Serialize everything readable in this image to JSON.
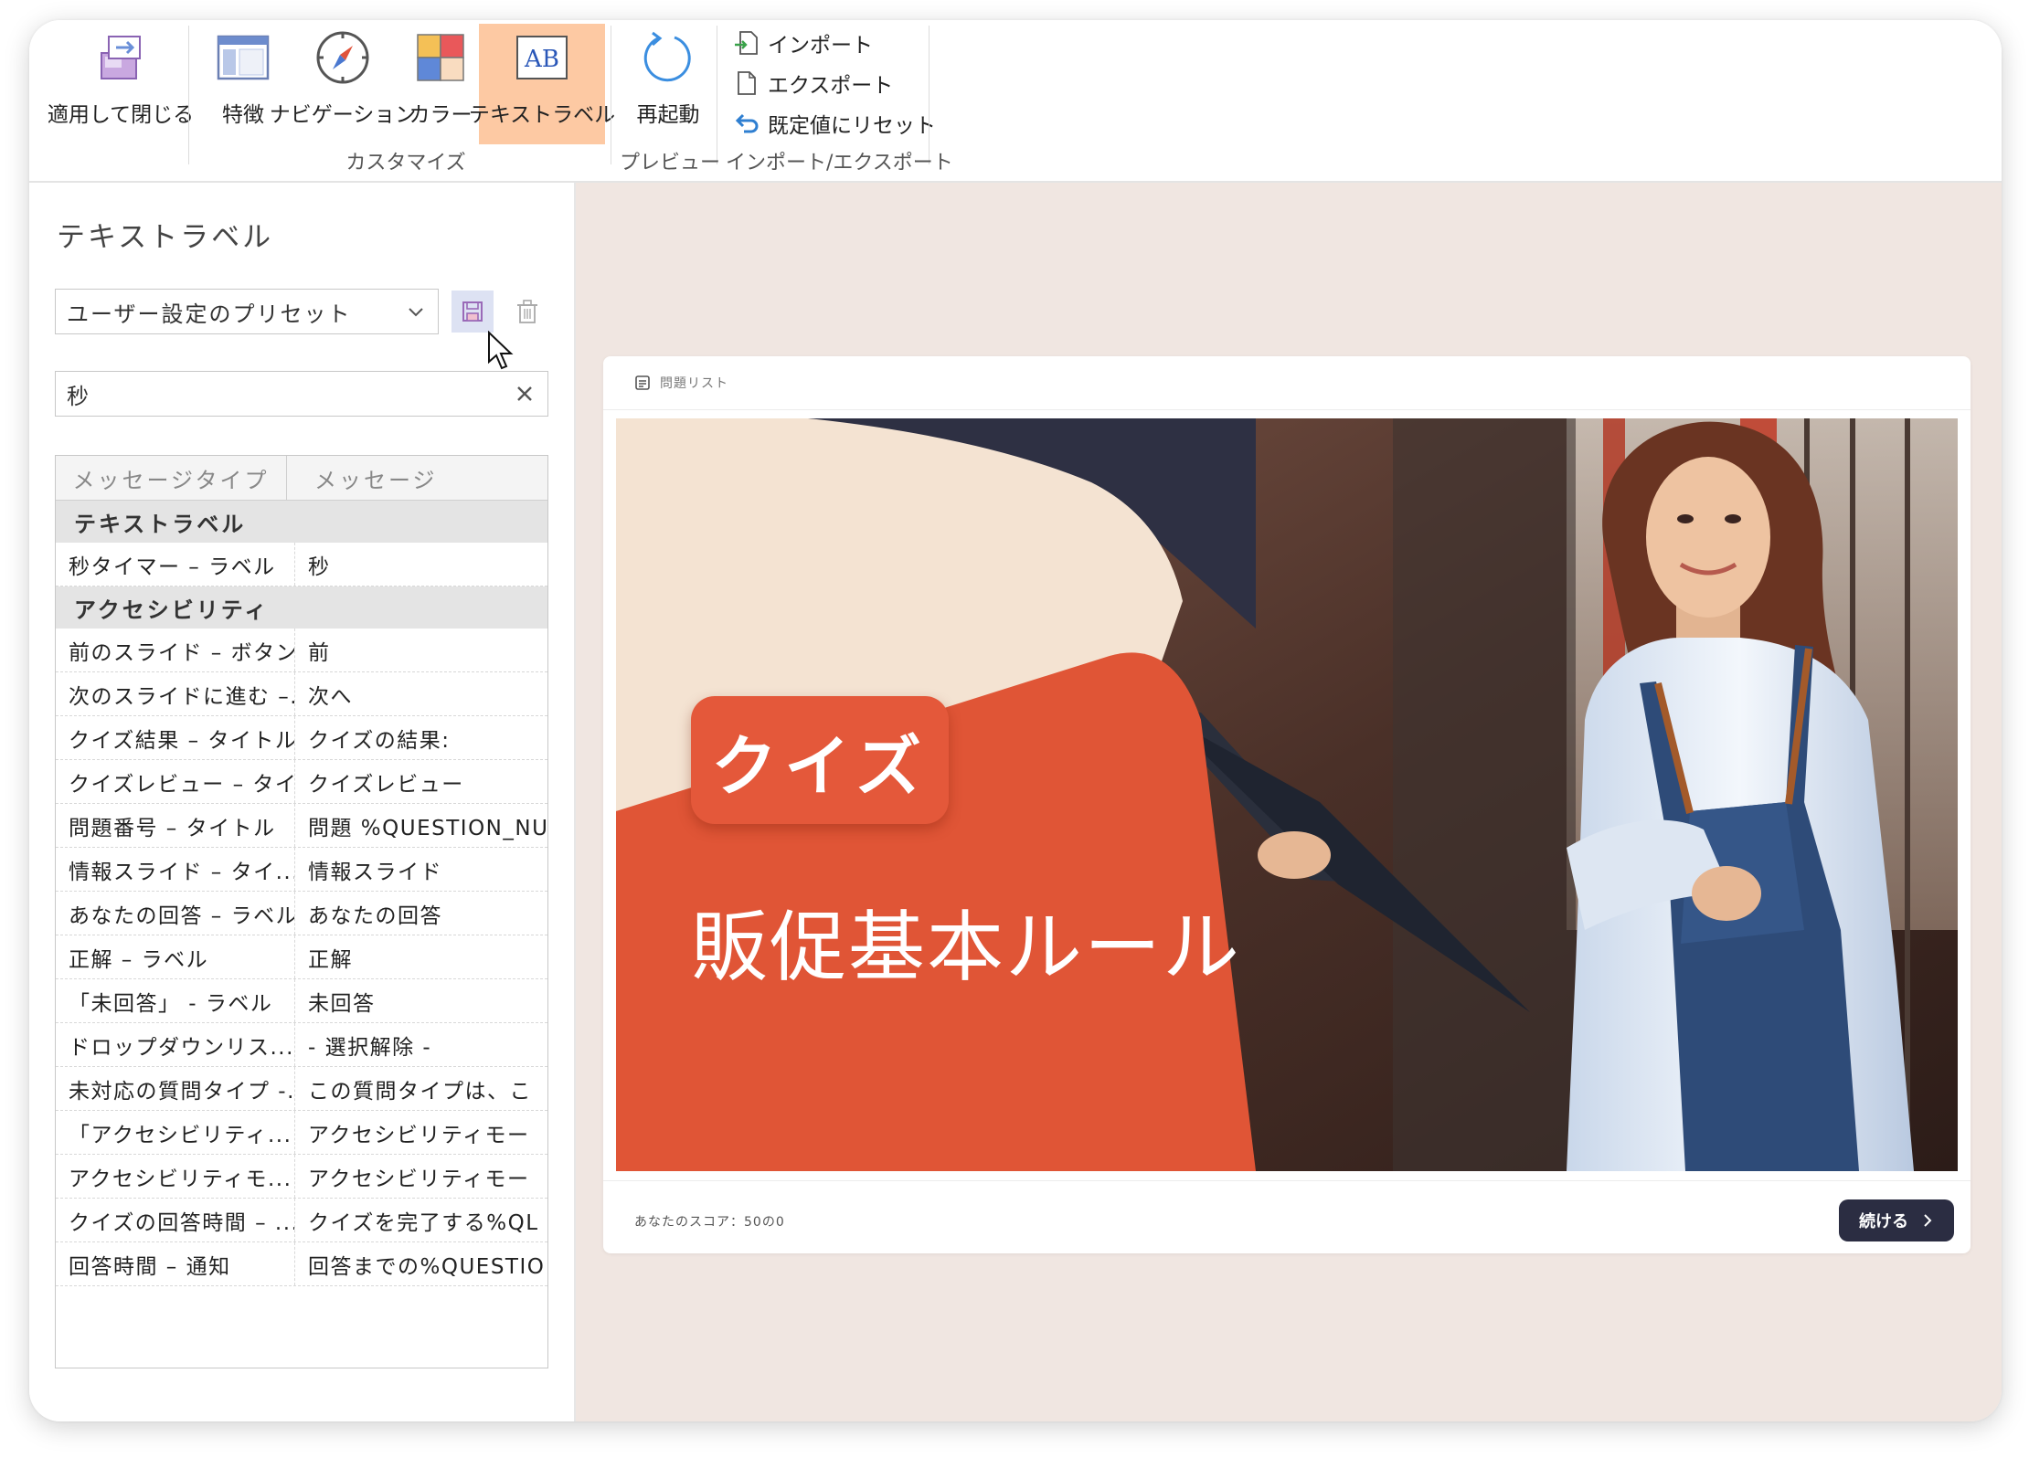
{
  "ribbon": {
    "apply_close": "適用して閉じる",
    "features": "特徴",
    "navigation": "ナビゲーション",
    "color": "カラー",
    "text_labels": "テキストラベル",
    "restart": "再起動",
    "import": "インポート",
    "export": "エクスポート",
    "reset": "既定値にリセット",
    "group_customize": "カスタマイズ",
    "group_preview": "プレビュー",
    "group_import_export": "インポート/エクスポート"
  },
  "panel": {
    "title": "テキストラベル",
    "preset": "ユーザー設定のプリセット",
    "search_value": "秒",
    "col_type": "メッセージタイプ",
    "col_message": "メッセージ",
    "sections": [
      {
        "name": "テキストラベル",
        "rows": [
          {
            "key": "秒タイマー – ラベル",
            "value": "秒"
          }
        ]
      },
      {
        "name": "アクセシビリティ",
        "rows": [
          {
            "key": "前のスライド – ボタン",
            "value": "前"
          },
          {
            "key": "次のスライドに進む –...",
            "value": "次へ"
          },
          {
            "key": "クイズ結果 – タイトル",
            "value": "クイズの結果:"
          },
          {
            "key": "クイズレビュー – タイ...",
            "value": "クイズレビュー"
          },
          {
            "key": "問題番号 – タイトル",
            "value": "問題 %QUESTION_NUI"
          },
          {
            "key": "情報スライド – タイ...",
            "value": "情報スライド"
          },
          {
            "key": "あなたの回答 – ラベル",
            "value": "あなたの回答"
          },
          {
            "key": "正解 – ラベル",
            "value": "正解"
          },
          {
            "key": "「未回答」 - ラベル",
            "value": "未回答"
          },
          {
            "key": "ドロップダウンリス...",
            "value": "- 選択解除 -"
          },
          {
            "key": "未対応の質問タイプ -...",
            "value": "この質問タイプは、こ"
          },
          {
            "key": "「アクセシビリティ...",
            "value": "アクセシビリティモー"
          },
          {
            "key": "アクセシビリティモ...",
            "value": "アクセシビリティモー"
          },
          {
            "key": "クイズの回答時間 – ...",
            "value": "クイズを完了する%QL"
          },
          {
            "key": "回答時間 – 通知",
            "value": "回答までの%QUESTIO"
          }
        ]
      }
    ]
  },
  "preview": {
    "question_list": "問題リスト",
    "badge": "クイズ",
    "slide_title": "販促基本ルール",
    "score": "あなたのスコア：50の0",
    "continue": "続ける"
  },
  "colors": {
    "accent_active": "#fdc9a3",
    "slide_orange": "#e05536",
    "slide_cream": "#f4e3d2",
    "slide_navy": "#2e3043",
    "button_dark": "#2b2d42",
    "preview_bg": "#f0e6e1"
  },
  "icons": [
    "apply-close-icon",
    "features-icon",
    "navigation-icon",
    "color-icon",
    "text-label-icon",
    "restart-icon",
    "import-icon",
    "export-icon",
    "reset-icon",
    "save-icon",
    "trash-icon",
    "clear-icon",
    "chevron-down-icon",
    "list-icon",
    "chevron-right-icon",
    "mouse-cursor-icon"
  ]
}
